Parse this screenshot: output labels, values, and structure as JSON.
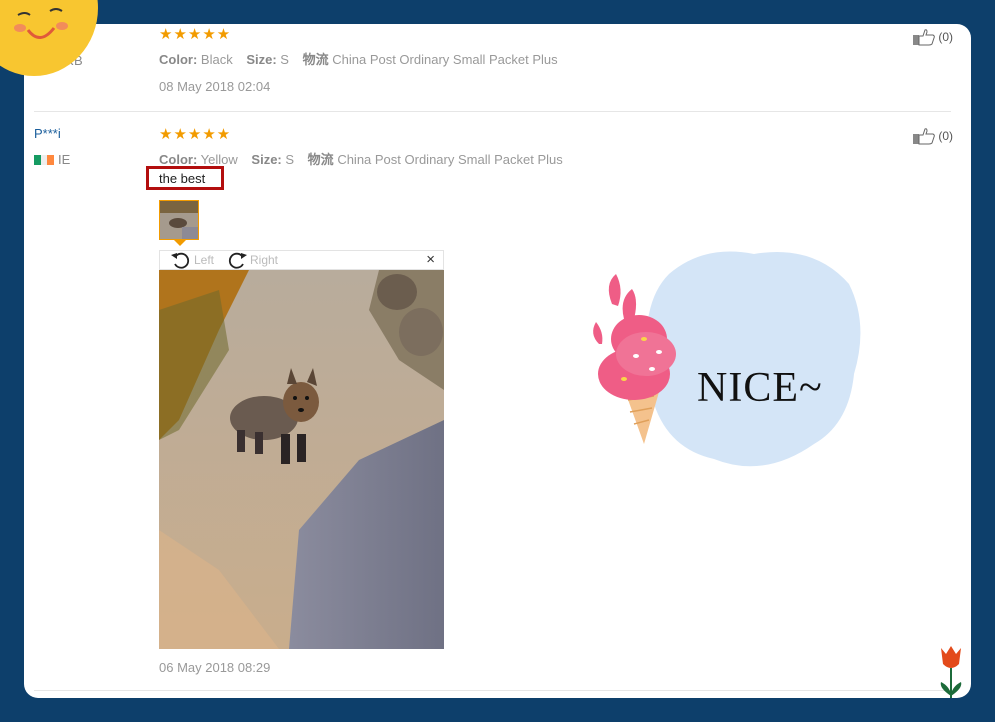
{
  "reviews": [
    {
      "country": "SRB",
      "stars": "★★★★★",
      "color_label": "Color:",
      "color_value": "Black",
      "size_label": "Size:",
      "size_value": "S",
      "shipping_label": "物流",
      "shipping_value": "China Post Ordinary Small Packet Plus",
      "date": "08 May 2018 02:04",
      "likes": "(0)"
    },
    {
      "user": "P***i",
      "country": "IE",
      "stars": "★★★★★",
      "color_label": "Color:",
      "color_value": "Yellow",
      "size_label": "Size:",
      "size_value": "S",
      "shipping_label": "物流",
      "shipping_value": "China Post Ordinary Small Packet Plus",
      "content": "the best",
      "date": "06 May 2018 08:29",
      "likes": "(0)"
    }
  ],
  "viewer": {
    "rotate_left": "Left",
    "rotate_right": "Right",
    "close": "×"
  },
  "sticker": {
    "text": "NICE~"
  },
  "colors": {
    "background": "#0d3f6b",
    "star": "#f29b00",
    "highlight_border": "#b30e0e",
    "username": "#1a5e9c"
  }
}
